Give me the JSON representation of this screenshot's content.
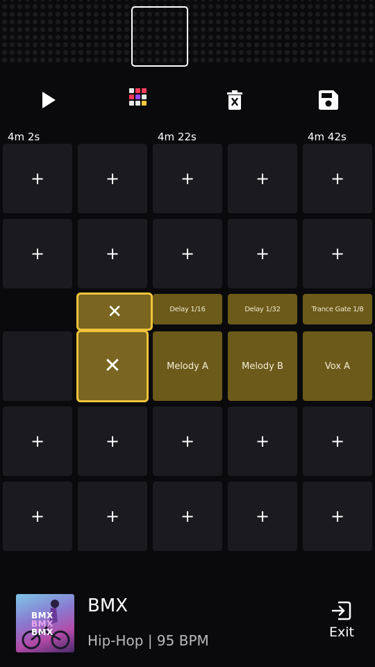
{
  "toolbar": {
    "play_icon": "play-icon",
    "pads_icon": "grid-pads-icon",
    "delete_icon": "trash-icon",
    "save_icon": "save-icon"
  },
  "timeline": [
    "4m 2s",
    "4m 22s",
    "4m 42s"
  ],
  "grid": {
    "add_symbol": "+",
    "remove_symbol": "✕",
    "effects": [
      "Delay 1/16",
      "Delay 1/32",
      "Trance Gate 1/8"
    ],
    "clips": [
      "Melody A",
      "Melody B",
      "Vox A"
    ]
  },
  "player": {
    "title": "BMX",
    "subtitle": "Hip-Hop | 95 BPM",
    "cover_text": "BMX",
    "exit_label": "Exit"
  },
  "colors": {
    "accent": "#f0c43a",
    "clip": "#6b5a1a",
    "cell": "#1b1b1f",
    "background": "#0a0a0c"
  }
}
